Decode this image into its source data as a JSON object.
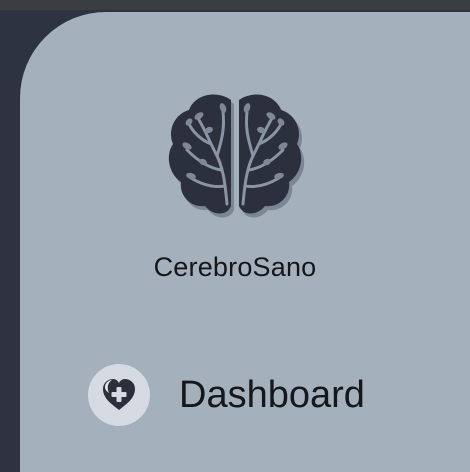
{
  "app": {
    "brand_name": "CerebroSano",
    "logo_icon": "brain-tree-icon"
  },
  "navigation": {
    "items": [
      {
        "label": "Dashboard",
        "icon": "heart-plus-icon"
      }
    ]
  },
  "colors": {
    "sidebar_background": "#a5b0bd",
    "page_background": "#2d3340",
    "icon_dark": "#2b303c",
    "icon_circle": "#d6dbe3"
  }
}
